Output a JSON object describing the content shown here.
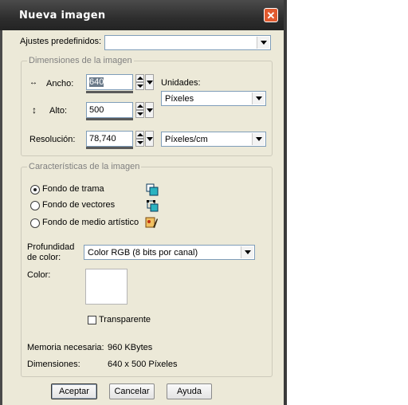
{
  "window": {
    "title": "Nueva imagen",
    "close_glyph": "✕"
  },
  "presets": {
    "label": "Ajustes predefinidos:",
    "value": ""
  },
  "dimensions": {
    "legend": "Dimensiones de la imagen",
    "width_label": "Ancho:",
    "width_value": "640",
    "height_label": "Alto:",
    "height_value": "500",
    "resolution_label": "Resolución:",
    "resolution_value": "78,740",
    "units_label": "Unidades:",
    "units_value": "Píxeles",
    "res_units_value": "Píxeles/cm"
  },
  "characteristics": {
    "legend": "Características de la imagen",
    "options": [
      {
        "label": "Fondo de trama",
        "selected": true,
        "icon": "raster-layer-icon"
      },
      {
        "label": "Fondo de vectores",
        "selected": false,
        "icon": "vector-layer-icon"
      },
      {
        "label": "Fondo de medio artístico",
        "selected": false,
        "icon": "art-media-icon"
      }
    ],
    "depth_label_1": "Profundidad",
    "depth_label_2": "de color:",
    "depth_value": "Color RGB (8 bits por canal)",
    "color_label": "Color:",
    "color_value": "#ffffff",
    "transparent_label": "Transparente",
    "transparent_checked": false,
    "memory_label": "Memoria necesaria:",
    "memory_value": "960 KBytes",
    "dims_label": "Dimensiones:",
    "dims_value": "640 x 500 Píxeles"
  },
  "buttons": {
    "ok": "Aceptar",
    "cancel": "Cancelar",
    "help": "Ayuda"
  }
}
